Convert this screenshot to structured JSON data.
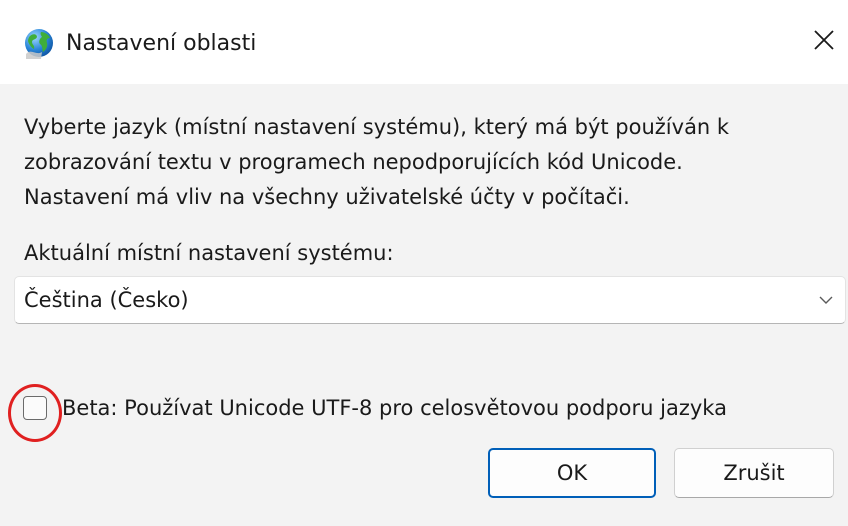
{
  "dialog": {
    "title": "Nastavení oblasti",
    "title_icon": "globe-icon",
    "close_icon": "close-icon"
  },
  "description": {
    "lines": [
      "Vyberte jazyk (místní nastavení systému), který má být používán k",
      "zobrazování textu v programech nepodporujících kód Unicode.",
      "Nastavení má vliv na všechny uživatelské účty v počítači."
    ]
  },
  "locale": {
    "label": "Aktuální místní nastavení systému:",
    "selected": "Čeština (Česko)",
    "icon": "chevron-down-icon"
  },
  "utf8_option": {
    "label": "Beta: Používat Unicode UTF-8 pro celosvětovou podporu jazyka",
    "checked": false
  },
  "buttons": {
    "ok": "OK",
    "cancel": "Zrušit"
  },
  "colors": {
    "accent": "#005fb8",
    "highlight": "#e02020",
    "dialog_background": "#f3f3f3"
  }
}
